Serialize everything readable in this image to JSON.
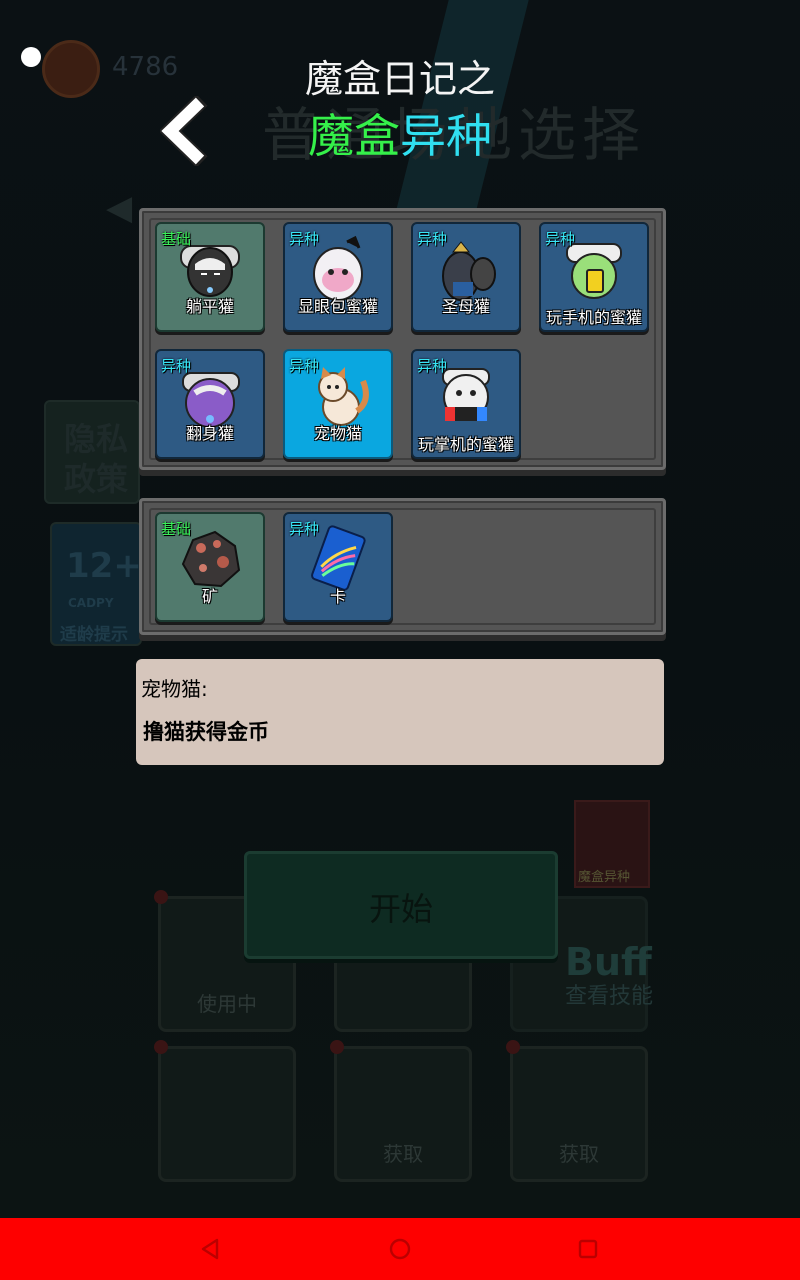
{
  "background": {
    "coins": "4786",
    "title": "普通场地选择",
    "slot_in_use": "使用中",
    "slot_get_1": "获取",
    "slot_get_2": "获取",
    "buff": "Buff",
    "buff_label": "查看技能",
    "magic_tile": "魔盒异种",
    "side_text_1": "隐私",
    "side_text_2": "政策",
    "age": "12+",
    "age_sub": "CADPY",
    "age_note": "适龄提示"
  },
  "header": {
    "line1": "魔盒日记之",
    "line2_green": "魔盒",
    "line2_cyan": "异种"
  },
  "characters": [
    {
      "tag": "基础",
      "name": "躺平獾",
      "kind": "basic",
      "art": "badger-lying"
    },
    {
      "tag": "异种",
      "name": "显眼包蜜獾",
      "kind": "alien",
      "art": "badger-pink"
    },
    {
      "tag": "异种",
      "name": "圣母獾",
      "kind": "alien",
      "art": "badger-holy"
    },
    {
      "tag": "异种",
      "name": "玩手机的蜜獾",
      "kind": "alien",
      "art": "badger-phone"
    },
    {
      "tag": "异种",
      "name": "翻身獾",
      "kind": "alien",
      "art": "badger-purple"
    },
    {
      "tag": "异种",
      "name": "宠物猫",
      "kind": "selected",
      "art": "cat"
    },
    {
      "tag": "异种",
      "name": "玩掌机的蜜獾",
      "kind": "alien",
      "art": "badger-console"
    }
  ],
  "items": [
    {
      "tag": "基础",
      "name": "矿",
      "kind": "basic",
      "art": "ore"
    },
    {
      "tag": "异种",
      "name": "卡",
      "kind": "alien",
      "art": "card"
    }
  ],
  "description": {
    "title": "宠物猫:",
    "body": "撸猫获得金币"
  },
  "start_button": "开始",
  "colors": {
    "tag_basic": "#3af05a",
    "tag_alien": "#38e6f6",
    "card_basic": "#517a6d",
    "card_alien": "#2e5a84",
    "card_selected": "#0aa7e0",
    "navbar": "#fe0000"
  },
  "navbar": {
    "back_icon": "triangle-back-icon",
    "home_icon": "circle-home-icon",
    "recents_icon": "square-recents-icon"
  }
}
